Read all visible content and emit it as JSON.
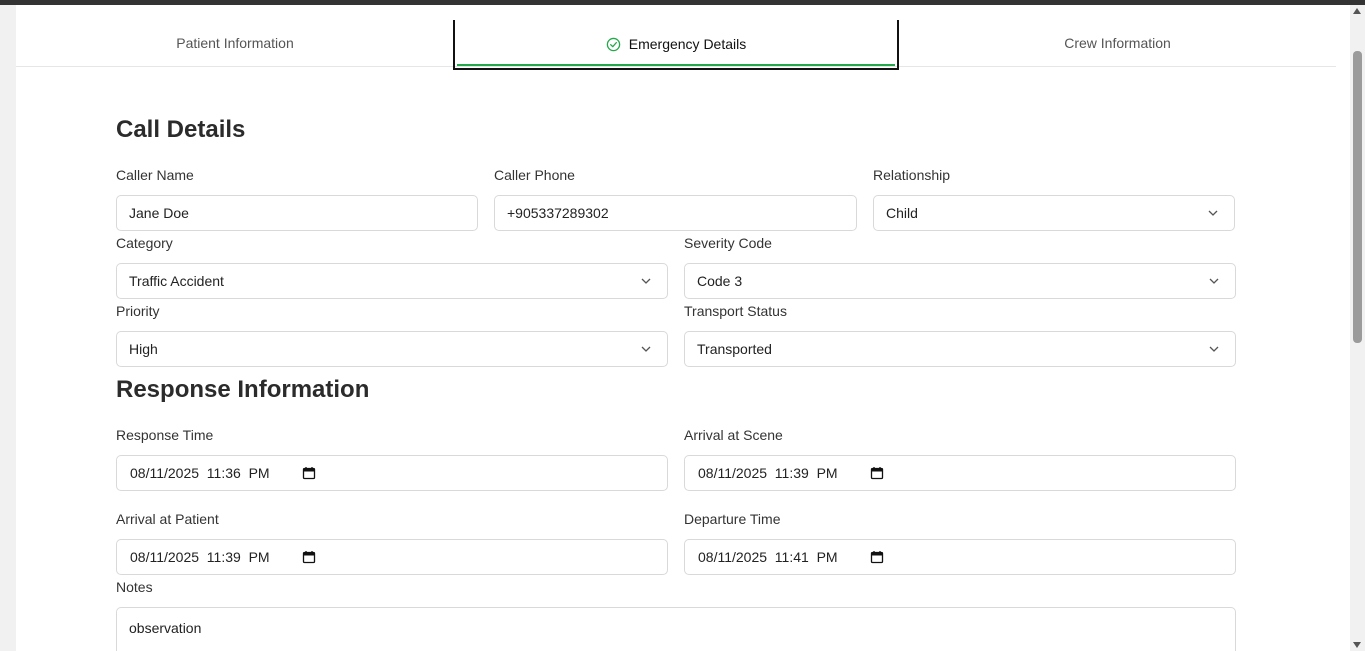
{
  "tabs": {
    "patient": "Patient Information",
    "emergency": "Emergency Details",
    "crew": "Crew Information"
  },
  "call_details": {
    "title": "Call Details",
    "caller_name_label": "Caller Name",
    "caller_name_value": "Jane Doe",
    "caller_phone_label": "Caller Phone",
    "caller_phone_value": "+905337289302",
    "relationship_label": "Relationship",
    "relationship_value": "Child",
    "category_label": "Category",
    "category_value": "Traffic Accident",
    "severity_label": "Severity Code",
    "severity_value": "Code 3",
    "priority_label": "Priority",
    "priority_value": "High",
    "transport_label": "Transport Status",
    "transport_value": "Transported"
  },
  "response_info": {
    "title": "Response Information",
    "response_time_label": "Response Time",
    "response_time_value": "08/11/2025  11:36  PM",
    "arrival_scene_label": "Arrival at Scene",
    "arrival_scene_value": "08/11/2025  11:39  PM",
    "arrival_patient_label": "Arrival at Patient",
    "arrival_patient_value": "08/11/2025  11:39  PM",
    "departure_label": "Departure Time",
    "departure_value": "08/11/2025  11:41  PM",
    "notes_label": "Notes",
    "notes_value": "observation"
  },
  "colors": {
    "accent": "#22a84a",
    "border": "#d9d9d9",
    "active_tab_border": "#111111"
  },
  "icons": {
    "active_tab": "check-circle-icon",
    "select": "chevron-down-icon",
    "datetime": "calendar-icon"
  }
}
